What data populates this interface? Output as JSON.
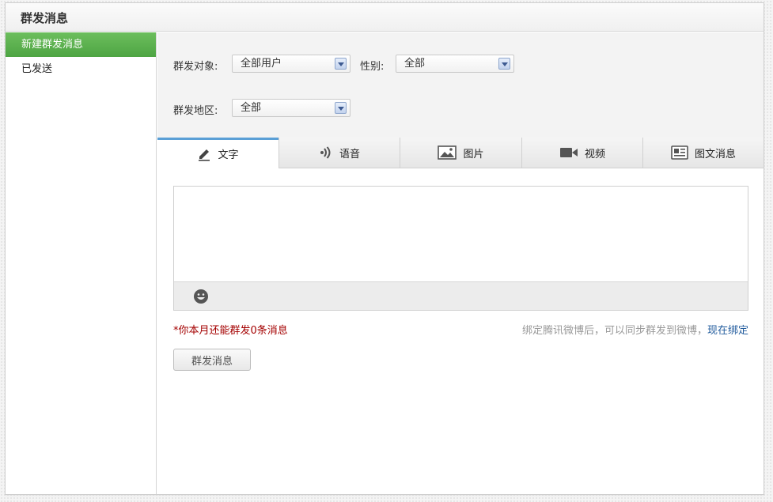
{
  "header": {
    "title": "群发消息"
  },
  "sidebar": {
    "items": [
      {
        "label": "新建群发消息",
        "active": true
      },
      {
        "label": "已发送",
        "active": false
      }
    ]
  },
  "filters": {
    "target": {
      "label": "群发对象:",
      "value": "全部用户"
    },
    "gender": {
      "label": "性别:",
      "value": "全部"
    },
    "region": {
      "label": "群发地区:",
      "value": "全部"
    }
  },
  "tabs": [
    {
      "label": "文字",
      "icon": "pencil-icon",
      "active": true
    },
    {
      "label": "语音",
      "icon": "sound-wave-icon",
      "active": false
    },
    {
      "label": "图片",
      "icon": "image-icon",
      "active": false
    },
    {
      "label": "视频",
      "icon": "video-camera-icon",
      "active": false
    },
    {
      "label": "图文消息",
      "icon": "news-icon",
      "active": false
    }
  ],
  "editor": {
    "value": "",
    "emoji_icon": "smiley-face-icon"
  },
  "quota": {
    "text": "*你本月还能群发0条消息"
  },
  "bind_tip": {
    "text": "绑定腾讯微博后，可以同步群发到微博，",
    "link": "现在绑定"
  },
  "actions": {
    "send_label": "群发消息"
  },
  "colors": {
    "accent_green": "#5cb14f",
    "tab_active_border": "#5a9fd6",
    "quota_red": "#a40000",
    "link_blue": "#1f5a9c"
  }
}
